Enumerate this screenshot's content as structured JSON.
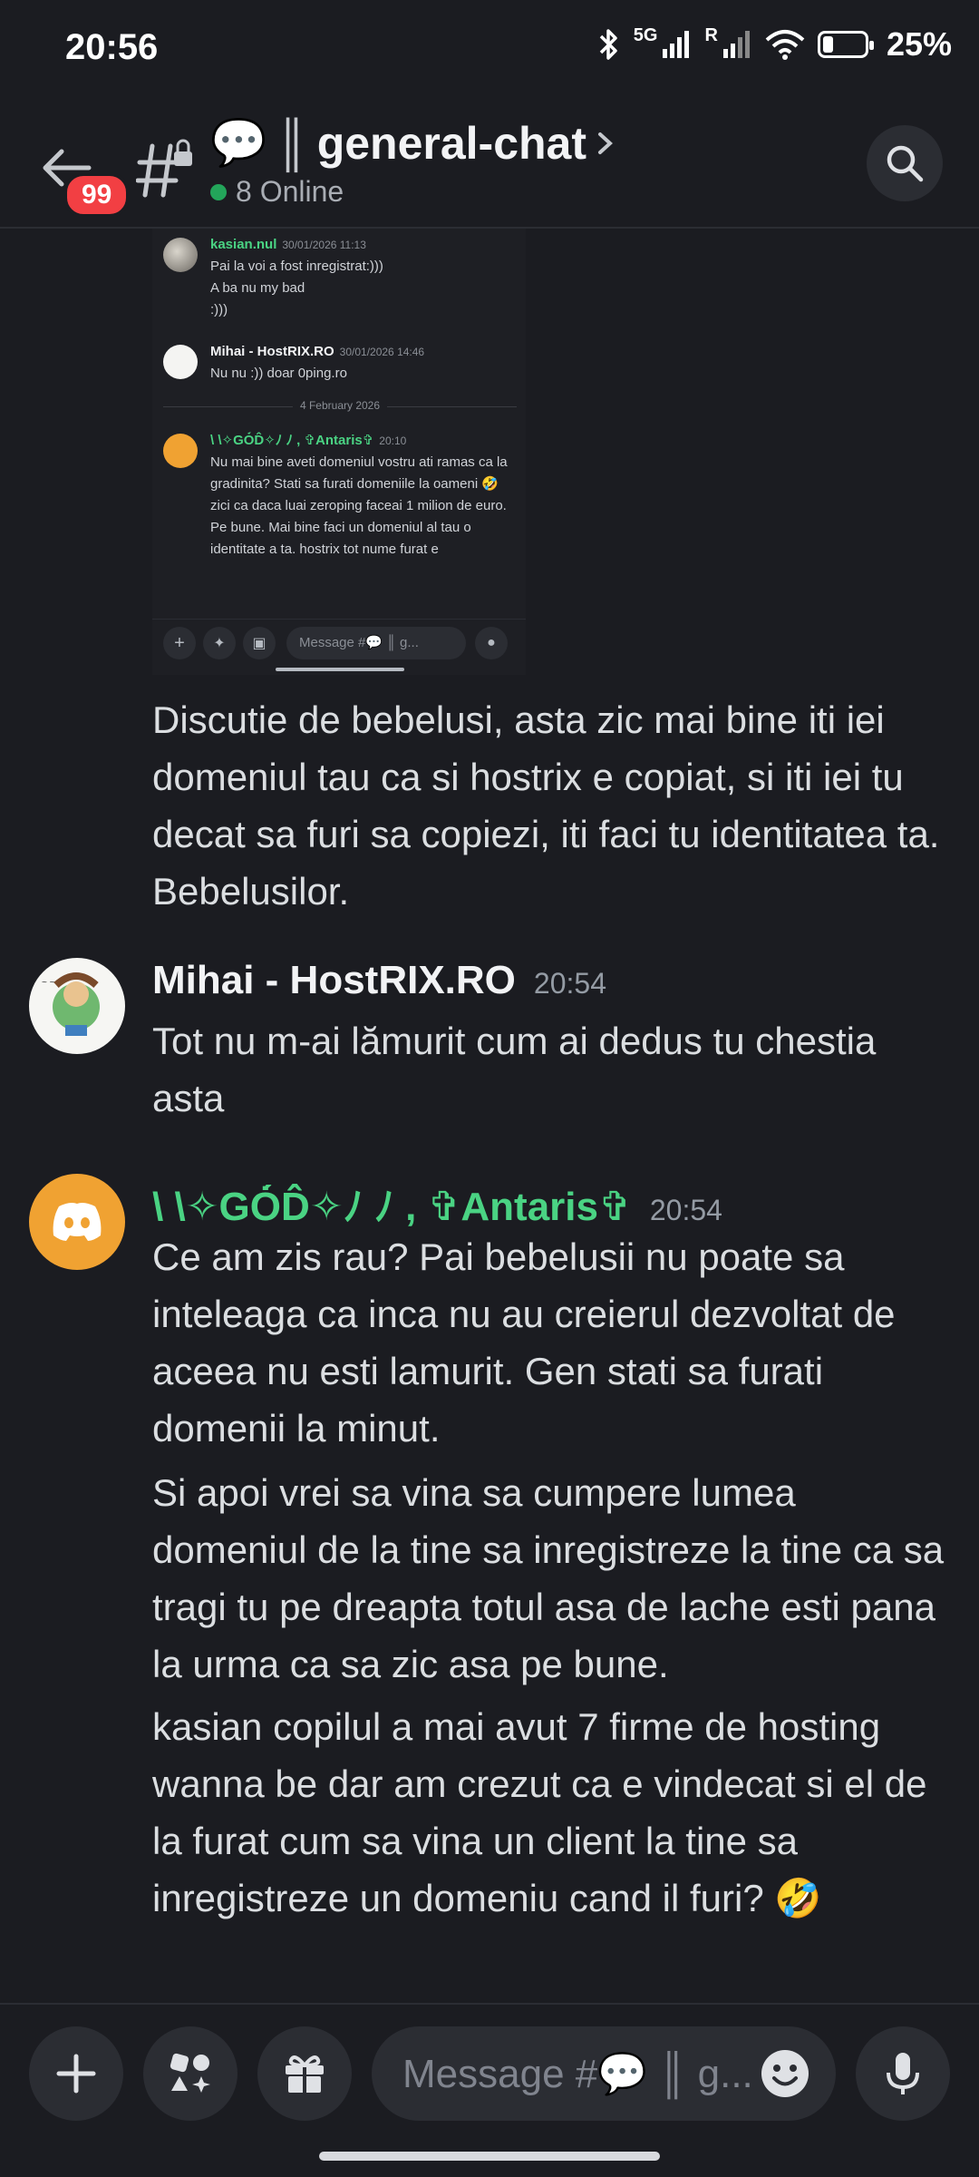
{
  "status": {
    "time": "20:56",
    "net_badge": "5G",
    "roaming": "R",
    "battery_pct": "25%",
    "battery_level": 0.25
  },
  "header": {
    "unread_badge": "99",
    "channel_emoji": "💬",
    "channel_sep": "║",
    "channel_name": "general-chat",
    "online_text": "8 Online"
  },
  "embed": {
    "messages": [
      {
        "author": "kasian.nul",
        "time": "30/01/2026 11:13",
        "lines": [
          "Pai la voi a fost inregistrat:)))",
          "A ba nu my bad",
          ":)))"
        ]
      },
      {
        "author": "Mihai - HostRIX.RO",
        "time": "30/01/2026 14:46",
        "lines": [
          "Nu nu :)) doar 0ping.ro"
        ]
      },
      {
        "author": "\\ \\✧GȮ́D̂✧ﾉ ﾉ , ✞Antaris✞",
        "time": "20:10",
        "text": "Nu mai bine aveti domeniul vostru ati ramas ca la gradinita? Stati sa furati domeniile la oameni 🤣 zici ca daca luai zeroping faceai 1 milion de euro. Pe bune. Mai bine faci un domeniul al tau o identitate a ta. hostrix tot nume furat e"
      }
    ],
    "date_divider": "4 February 2026",
    "input_placeholder": "Message #💬 ║ g..."
  },
  "chat": {
    "continuation_text": "Discutie de bebelusi, asta zic mai bine iti iei domeniul tau ca si hostrix e copiat, si iti iei tu decat sa furi sa copiezi, iti faci tu identitatea ta. Bebelusilor.",
    "messages": [
      {
        "author": "Mihai - HostRIX.RO",
        "time": "20:54",
        "texts": [
          "Tot nu m-ai lămurit cum ai dedus tu chestia asta"
        ]
      },
      {
        "author": "\\ \\✧GȮ́D̂✧ﾉ ﾉ , ✞Antaris✞",
        "time": "20:54",
        "texts": [
          "Ce am zis rau? Pai bebelusii nu poate sa inteleaga ca inca nu au creierul dezvoltat de aceea nu esti lamurit. Gen stati sa furati domenii la minut.",
          "Si apoi vrei sa vina sa cumpere lumea domeniul de la tine sa inregistreze la tine ca sa tragi tu pe dreapta totul asa de lache esti pana la urma ca sa zic asa pe bune.",
          "kasian copilul a mai avut 7 firme de hosting wanna be dar am crezut ca e vindecat si el de la furat cum sa vina un client la tine sa inregistreze un domeniu cand il furi? 🤣"
        ]
      }
    ]
  },
  "composer": {
    "placeholder": "Message #💬 ║ g..."
  },
  "colors": {
    "background": "#1b1c21",
    "username_green": "#4ad383",
    "badge_red": "#f23f43",
    "online_green": "#23a55a",
    "discord_avatar_orange": "#f0a232"
  }
}
